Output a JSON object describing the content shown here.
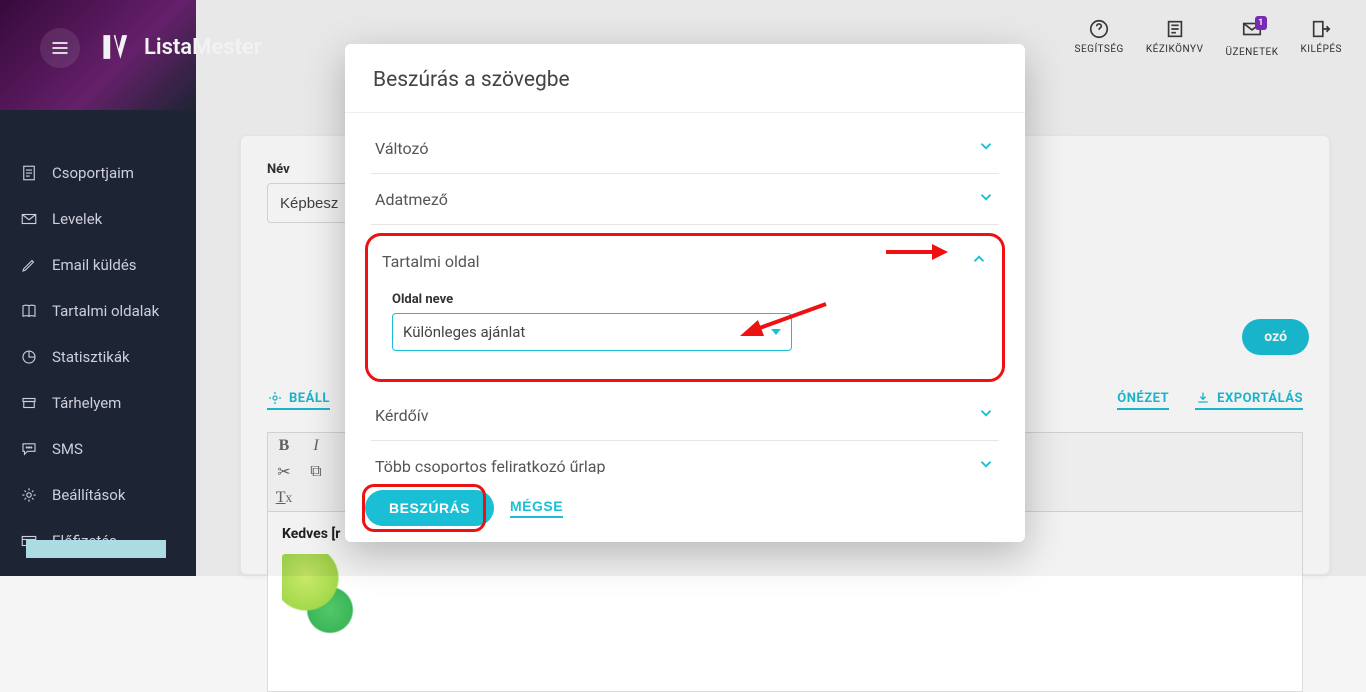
{
  "brand": "ListaMester",
  "topbar": {
    "help": "SEGÍTSÉG",
    "manual": "KÉZIKÖNYV",
    "messages": "ÜZENETEK",
    "messages_badge": "1",
    "logout": "KILÉPÉS"
  },
  "sidebar": {
    "items": [
      {
        "label": "Csoportjaim"
      },
      {
        "label": "Levelek"
      },
      {
        "label": "Email küldés"
      },
      {
        "label": "Tartalmi oldalak"
      },
      {
        "label": "Statisztikák"
      },
      {
        "label": "Tárhelyem"
      },
      {
        "label": "SMS"
      },
      {
        "label": "Beállítások"
      },
      {
        "label": "Előfizetés"
      }
    ]
  },
  "page": {
    "name_label": "Név",
    "name_value": "Képbesz",
    "chip": "ozó",
    "links": {
      "settings": "BEÁLL",
      "preview": "ÓNÉZET",
      "export": "EXPORTÁLÁS"
    },
    "greeting": "Kedves [r"
  },
  "modal": {
    "title": "Beszúrás a szövegbe",
    "accordion": {
      "variable": "Változó",
      "datafield": "Adatmező",
      "content_page": "Tartalmi oldal",
      "page_name_label": "Oldal neve",
      "page_name_value": "Különleges ajánlat",
      "questionnaire": "Kérdőív",
      "multi_signup": "Több csoportos feliratkozó űrlap"
    },
    "footer": {
      "insert": "BESZÚRÁS",
      "cancel": "MÉGSE"
    }
  }
}
